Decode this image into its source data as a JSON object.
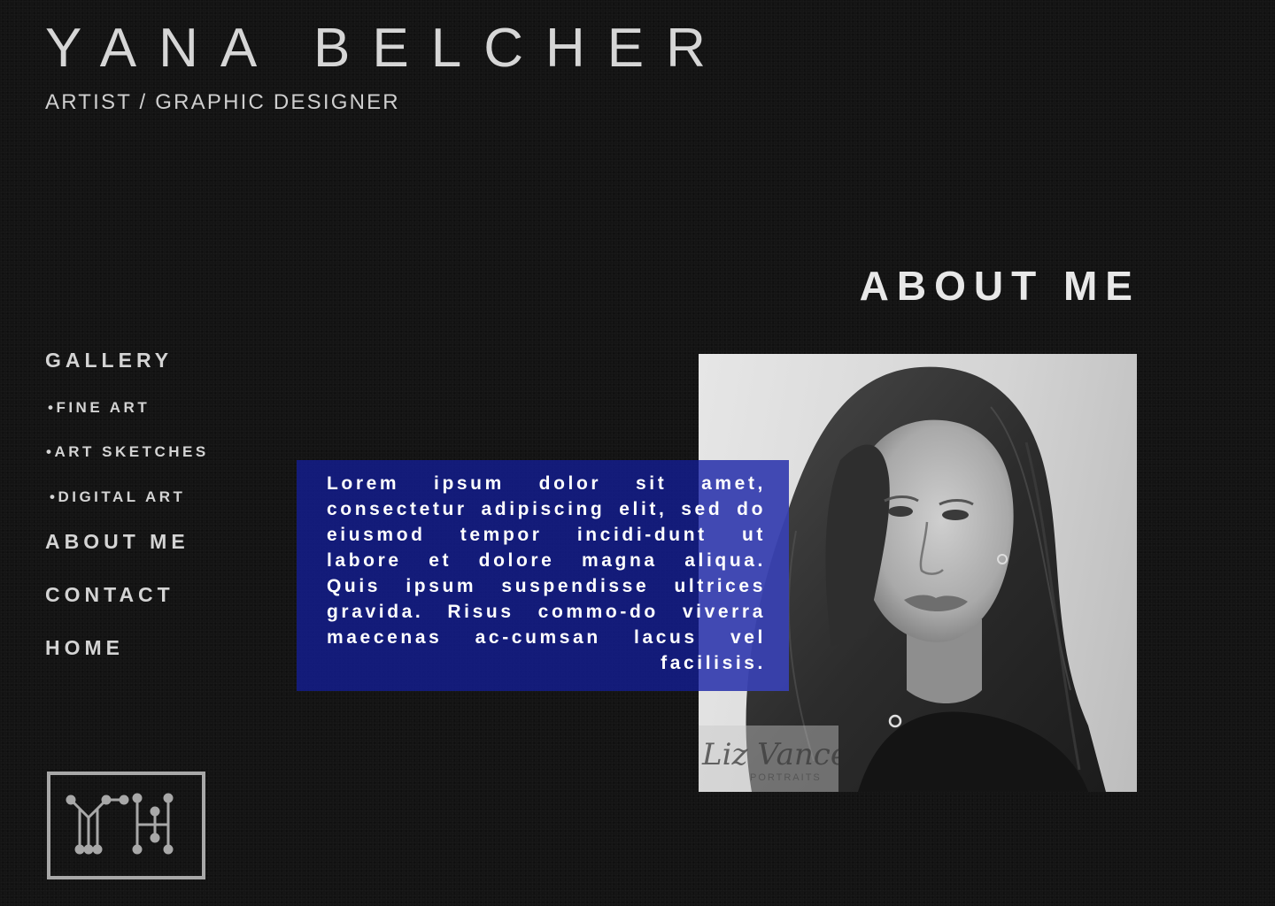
{
  "header": {
    "title": "YANA BELCHER",
    "subtitle": "ARTIST / GRAPHIC DESIGNER"
  },
  "page": {
    "heading": "ABOUT ME"
  },
  "nav": {
    "gallery": "GALLERY",
    "fine_art": "•FINE ART",
    "art_sketches": "•ART SKETCHES",
    "digital_art": "•DIGITAL ART",
    "about_me": "ABOUT ME",
    "contact": "CONTACT",
    "home": "HOME"
  },
  "about": {
    "text": "Lorem ipsum dolor sit amet, consectetur adipiscing elit, sed do eiusmod tempor incidi-dunt ut labore et dolore magna aliqua. Quis ipsum suspendisse ultrices gravida. Risus commo-do viverra maecenas ac-cumsan lacus vel facilisis."
  },
  "photo": {
    "watermark_name": "Liz Vance",
    "watermark_sub": "PORTRAITS"
  },
  "logo": {
    "icon": "yh-monogram-icon"
  },
  "colors": {
    "background": "#121212",
    "text_box": "#141c82",
    "text": "#d9d9d9"
  }
}
